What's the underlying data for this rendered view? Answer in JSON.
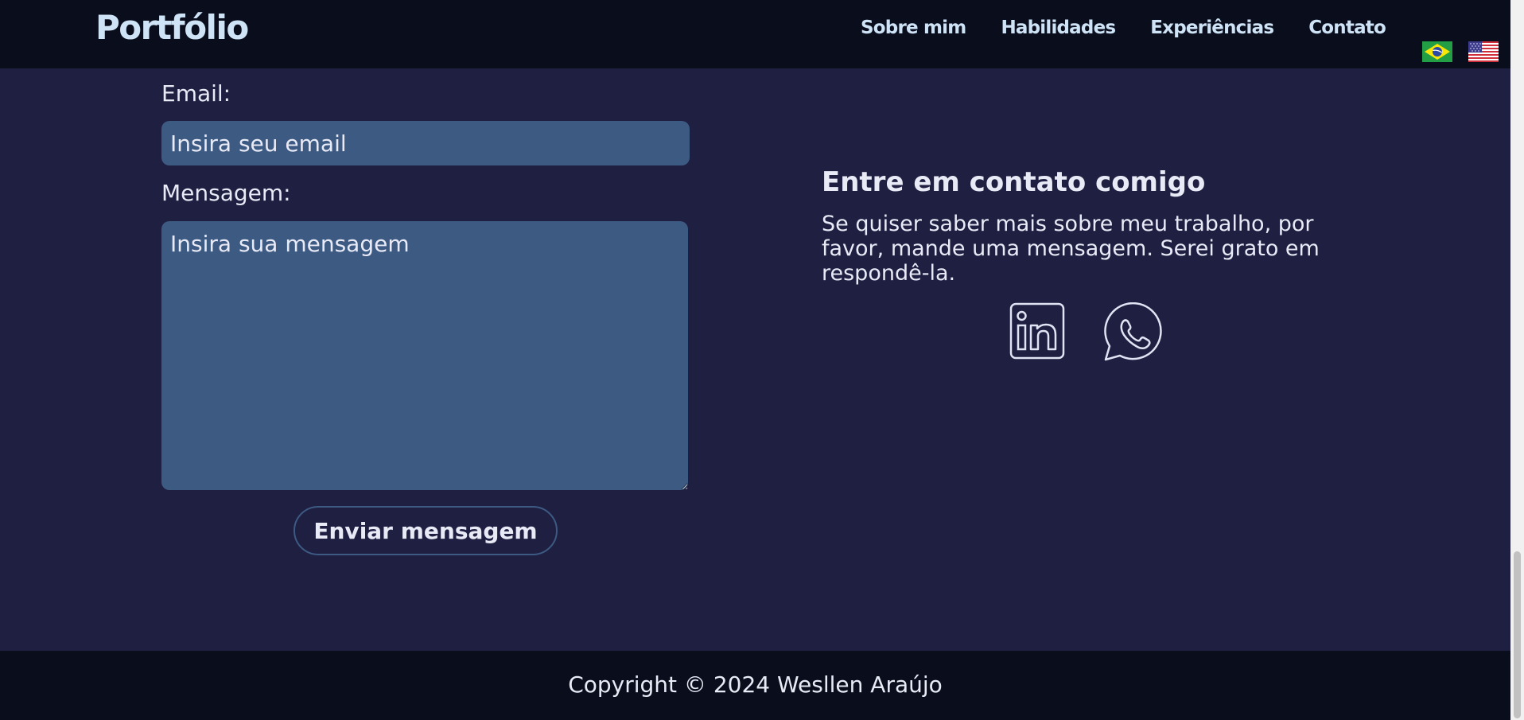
{
  "header": {
    "logo": "Portfólio",
    "nav": [
      "Sobre mim",
      "Habilidades",
      "Experiências",
      "Contato"
    ],
    "languages": [
      "pt-BR",
      "en-US"
    ]
  },
  "form": {
    "email_label": "Email:",
    "email_placeholder": "Insira seu email",
    "message_label": "Mensagem:",
    "message_placeholder": "Insira sua mensagem",
    "submit_label": "Enviar mensagem"
  },
  "contact": {
    "title": "Entre em contato comigo",
    "text": "Se quiser saber mais sobre meu trabalho, por favor, mande uma mensagem. Serei grato em respondê-la.",
    "social": [
      "linkedin-icon",
      "whatsapp-icon"
    ]
  },
  "footer": {
    "copyright": "Copyright © 2024 Wesllen Araújo"
  },
  "colors": {
    "background": "#1f1f42",
    "header": "#090d1c",
    "input": "#3d5a83",
    "text": "#e8eaf6"
  }
}
